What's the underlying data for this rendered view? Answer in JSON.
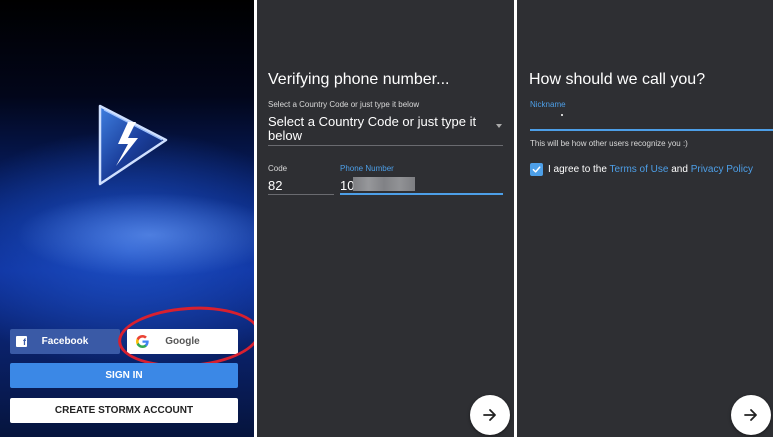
{
  "login": {
    "facebook_label": "Facebook",
    "google_label": "Google",
    "signin_label": "SIGN IN",
    "create_label": "CREATE STORMX ACCOUNT"
  },
  "verify": {
    "title": "Verifying phone number...",
    "country_hint": "Select a Country Code or just type it below",
    "country_select": "Select a Country Code or just type it below",
    "code_label": "Code",
    "code_value": "82",
    "phone_label": "Phone Number",
    "phone_value": "10"
  },
  "nickname": {
    "title": "How should we call you?",
    "nickname_label": "Nickname",
    "helper": "This will be how other users recognize you :)",
    "agree_prefix": "I agree to the",
    "terms": "Terms of Use",
    "and": "and",
    "privacy": "Privacy Policy"
  },
  "colors": {
    "accent": "#4d9fe8",
    "dark_bg": "#2e2f33",
    "facebook": "#3a5aa6",
    "signin": "#3b88e6",
    "highlight_circle": "#d8202f"
  },
  "icons": [
    "stormx-logo",
    "facebook-icon",
    "google-icon",
    "dropdown-caret-icon",
    "check-icon",
    "arrow-right-icon"
  ]
}
